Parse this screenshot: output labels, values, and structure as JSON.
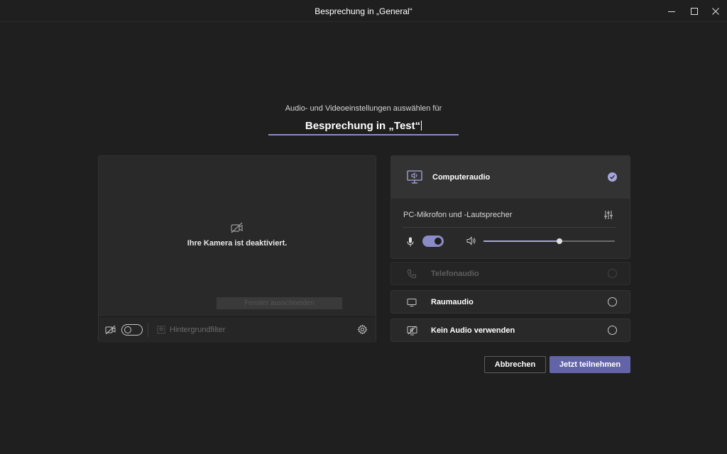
{
  "window": {
    "title": "Besprechung in „General“",
    "controls": [
      "minimize-icon",
      "maximize-icon",
      "close-icon"
    ]
  },
  "header": {
    "subtitle": "Audio- und Videoeinstellungen auswählen für",
    "meeting_name": "Besprechung in „Test“"
  },
  "video": {
    "camera_off_text": "Ihre Kamera ist deaktiviert.",
    "ghost_button_label": "Fenster ausschneiden",
    "camera_enabled": false,
    "background_filter_label": "Hintergrundfilter"
  },
  "audio": {
    "computer_audio": {
      "label": "Computeraudio",
      "selected": true,
      "device_label": "PC-Mikrofon und -Lautsprecher",
      "mic_enabled": true,
      "volume_fraction": 0.58
    },
    "options": [
      {
        "label": "Telefonaudio",
        "icon": "phone-icon",
        "enabled": false
      },
      {
        "label": "Raumaudio",
        "icon": "room-display-icon",
        "enabled": true
      },
      {
        "label": "Kein Audio verwenden",
        "icon": "no-audio-icon",
        "enabled": true
      }
    ]
  },
  "actions": {
    "cancel_label": "Abbrechen",
    "join_label": "Jetzt teilnehmen"
  },
  "colors": {
    "accent": "#6264a7",
    "accent_light": "#8b8cc7",
    "background": "#1f1f1f",
    "panel": "#292929"
  }
}
